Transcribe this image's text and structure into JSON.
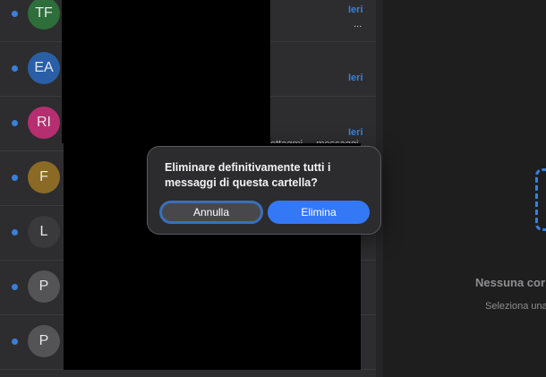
{
  "message_list": {
    "rows": [
      {
        "initials": "TF",
        "avatar_color": "#2d6e3a",
        "date": "Ieri",
        "more": "..."
      },
      {
        "initials": "EA",
        "avatar_color": "#2a5fa8",
        "date": "Ieri"
      },
      {
        "initials": "RI",
        "avatar_color": "#b52e6f",
        "date": "Ieri",
        "snippet": "ettagmi ... messaggi ... N"
      },
      {
        "initials": "F",
        "avatar_color": "#8a6a25",
        "date": ""
      },
      {
        "initials": "L",
        "avatar_color": "#3a3a3c",
        "date": ""
      },
      {
        "initials": "P",
        "avatar_color": "#545456",
        "date": ""
      },
      {
        "initials": "P",
        "avatar_color": "#545456",
        "date": ""
      }
    ],
    "unread_dot_color": "#3a7fd9"
  },
  "detail": {
    "empty_title": "Nessuna cor",
    "empty_subtitle": "Seleziona una"
  },
  "dialog": {
    "message": "Eliminare definitivamente tutti i messaggi di questa cartella?",
    "cancel_label": "Annulla",
    "confirm_label": "Elimina"
  }
}
